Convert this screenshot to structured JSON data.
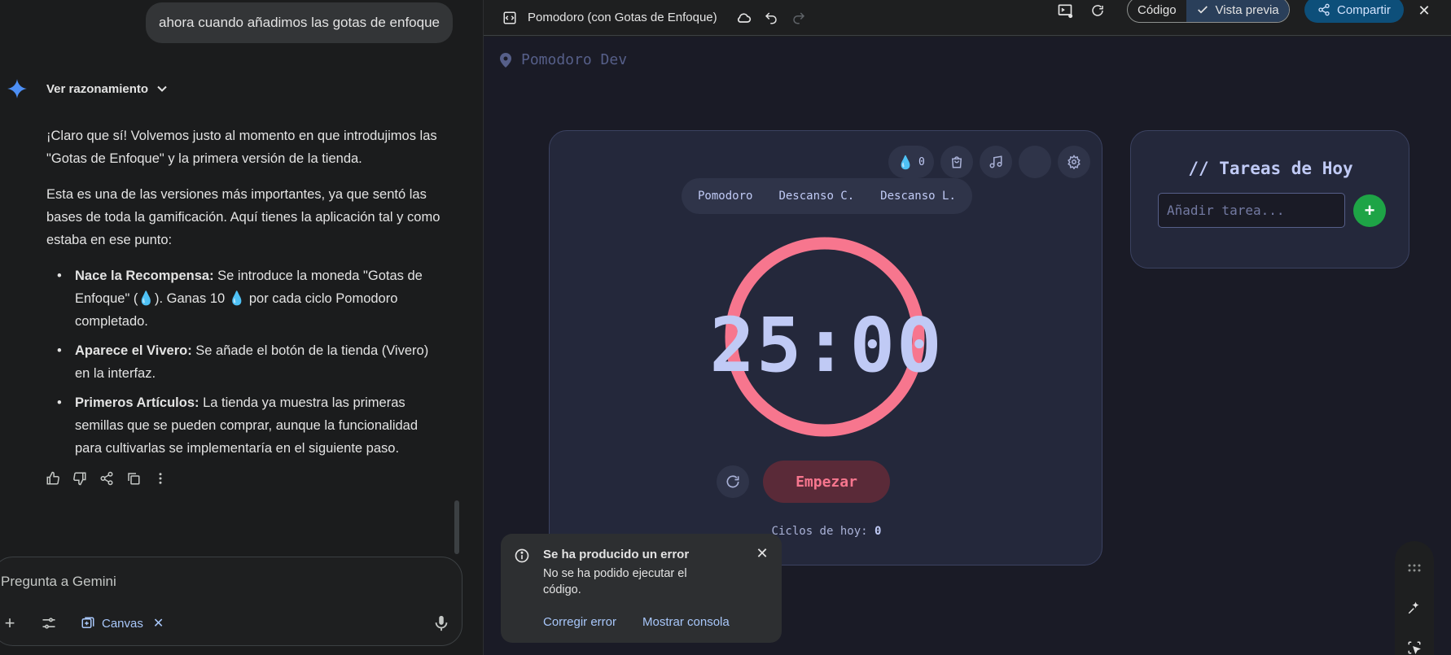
{
  "chat": {
    "user_message": "ahora cuando añadimos las gotas de enfoque",
    "reasoning_label": "Ver razonamiento",
    "answer": {
      "p1": "¡Claro que sí! Volvemos justo al momento en que introdujimos las \"Gotas de Enfoque\" y la primera versión de la tienda.",
      "p2": "Esta es una de las versiones más importantes, ya que sentó las bases de toda la gamificación. Aquí tienes la aplicación tal y como estaba en ese punto:",
      "bullets": [
        {
          "bold": "Nace la Recompensa:",
          "text": " Se introduce la moneda \"Gotas de Enfoque\" (💧). Ganas 10 💧 por cada ciclo Pomodoro completado."
        },
        {
          "bold": "Aparece el Vivero:",
          "text": " Se añade el botón de la tienda (Vivero) en la interfaz."
        },
        {
          "bold": "Primeros Artículos:",
          "text": " La tienda ya muestra las primeras semillas que se pueden comprar, aunque la funcionalidad para cultivarlas se implementaría en el siguiente paso."
        }
      ]
    },
    "prompt_placeholder": "Pregunta a Gemini",
    "canvas_chip": "Canvas"
  },
  "canvas": {
    "title": "Pomodoro (con Gotas de Enfoque)",
    "code_label": "Código",
    "preview_label": "Vista previa",
    "share_label": "Compartir"
  },
  "app": {
    "location": "Pomodoro Dev",
    "drops_count": "0",
    "modes": [
      "Pomodoro",
      "Descanso C.",
      "Descanso L."
    ],
    "time": "25:00",
    "start_label": "Empezar",
    "cycles_label": "Ciclos de hoy:",
    "cycles_value": "0",
    "tasks_title": "// Tareas de Hoy",
    "task_placeholder": "Añadir tarea...",
    "add_label": "+"
  },
  "toast": {
    "title": "Se ha producido un error",
    "message": "No se ha podido ejecutar el código.",
    "fix_label": "Corregir error",
    "console_label": "Mostrar consola"
  },
  "colors": {
    "ring": "#f7768e",
    "accent": "#a8c7fa",
    "add": "#1ea446"
  }
}
